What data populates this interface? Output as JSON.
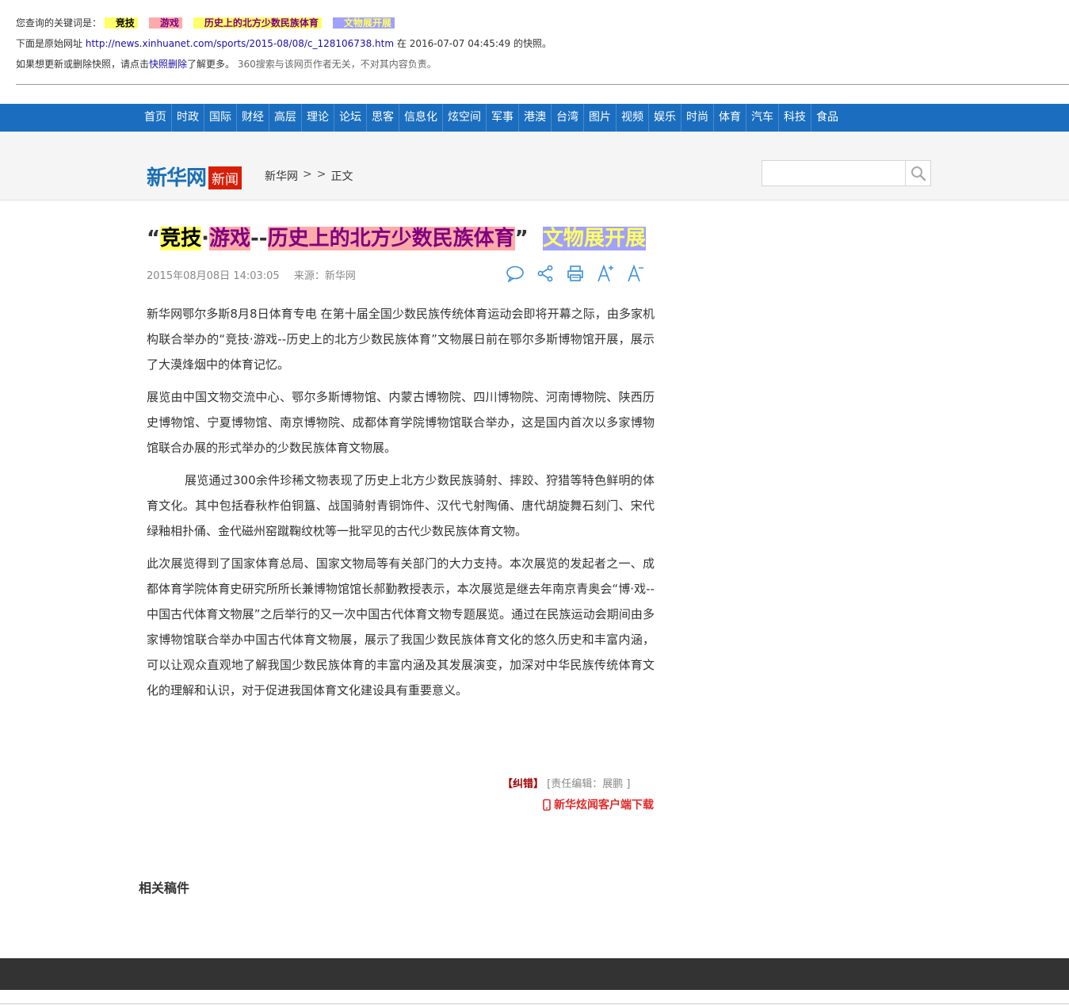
{
  "cache": {
    "query_label": "您查询的关键词是：",
    "keywords": [
      "竞技",
      "游戏",
      "历史上的北方少数民族体育",
      "文物展开展"
    ],
    "original_prefix": "下面是原始网址",
    "original_url": "http://news.xinhuanet.com/sports/2015-08/08/c_128106738.htm",
    "snapshot_mid": "在",
    "snapshot_time": "2016-07-07 04:45:49",
    "snapshot_suffix": "的快照。",
    "notice_prefix": "如果想更新或删除快照，请点击",
    "notice_link": "快照删除",
    "notice_mid": "了解更多。",
    "disclaimer": "360搜索与该网页作者无关，不对其内容负责。"
  },
  "nav": {
    "items": [
      "首页",
      "时政",
      "国际",
      "财经",
      "高层",
      "理论",
      "论坛",
      "思客",
      "信息化",
      "炫空间",
      "军事",
      "港澳",
      "台湾",
      "图片",
      "视频",
      "娱乐",
      "时尚",
      "体育",
      "汽车",
      "科技",
      "食品"
    ]
  },
  "site": {
    "logo_text": "新华网",
    "logo_badge": "新闻",
    "breadcrumb_home": "新华网",
    "breadcrumb_sep": ">",
    "breadcrumb_current": "正文",
    "search_placeholder": ""
  },
  "article": {
    "title_open_quote": "“",
    "title_kw1": "竞技",
    "title_dot": "·",
    "title_kw2": "游戏",
    "title_dash": "--",
    "title_kw3": "历史上的北方少数民族体育",
    "title_close_quote": "”",
    "title_kw4": "文物展开展",
    "date": "2015年08月08日 14:03:05",
    "source": "来源：新华网",
    "paragraphs": [
      "新华网鄂尔多斯8月8日体育专电 在第十届全国少数民族传统体育运动会即将开幕之际，由多家机构联合举办的“竞技·游戏--历史上的北方少数民族体育”文物展日前在鄂尔多斯博物馆开展，展示了大漠烽烟中的体育记忆。",
      "展览由中国文物交流中心、鄂尔多斯博物馆、内蒙古博物院、四川博物院、河南博物院、陕西历史博物馆、宁夏博物馆、南京博物院、成都体育学院博物馆联合举办，这是国内首次以多家博物馆联合办展的形式举办的少数民族体育文物展。",
      "展览通过300余件珍稀文物表现了历史上北方少数民族骑射、摔跤、狩猎等特色鲜明的体育文化。其中包括春秋柞伯铜簋、战国骑射青铜饰件、汉代弋射陶俑、唐代胡旋舞石刻门、宋代绿釉相扑俑、金代磁州窑蹴鞠纹枕等一批罕见的古代少数民族体育文物。",
      "此次展览得到了国家体育总局、国家文物局等有关部门的大力支持。本次展览的发起者之一、成都体育学院体育史研究所所长兼博物馆馆长郝勤教授表示，本次展览是继去年南京青奥会“博·戏--中国古代体育文物展”之后举行的又一次中国古代体育文物专题展览。通过在民族运动会期间由多家博物馆联合举办中国古代体育文物展，展示了我国少数民族体育文化的悠久历史和丰富内涵，可以让观众直观地了解我国少数民族体育的丰富内涵及其发展演变，加深对中华民族传统体育文化的理解和认识，对于促进我国体育文化建设具有重要意义。"
    ],
    "error_report": "【纠错】",
    "editor": "[责任编辑：展鹏 ]",
    "app_download": "新华炫闻客户端下载"
  },
  "related": {
    "title": "相关稿件"
  },
  "colors": {
    "nav_bg": "#1b6ebf",
    "logo_blue": "#1a6fb5",
    "badge_red": "#d81e06",
    "footer": "#333333"
  },
  "icons": [
    "comment-icon",
    "share-icon",
    "print-icon",
    "font-increase-icon",
    "font-decrease-icon",
    "search-icon",
    "mobile-icon"
  ]
}
